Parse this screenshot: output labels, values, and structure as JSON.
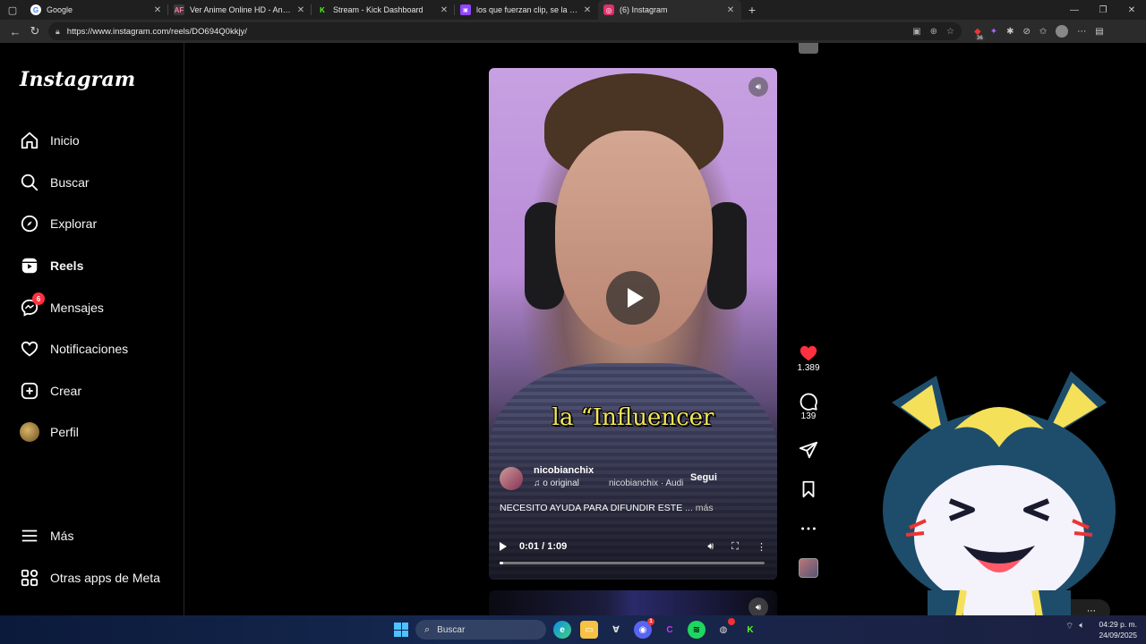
{
  "browser": {
    "tabs": [
      {
        "title": "Google",
        "favicon_color": "#ffffff",
        "favicon_glyph": "G"
      },
      {
        "title": "Ver Anime Online HD - AnimeFLV",
        "favicon_color": "#3a3a3a",
        "favicon_glyph": "AF"
      },
      {
        "title": "Stream - Kick Dashboard",
        "favicon_color": "#53fc18",
        "favicon_glyph": "K"
      },
      {
        "title": "los que fuerzan clip, se la comen",
        "favicon_color": "#9146ff",
        "favicon_glyph": "▣"
      },
      {
        "title": "(6) Instagram",
        "favicon_color": "#e1306c",
        "favicon_glyph": "◎"
      }
    ],
    "active_tab_index": 4,
    "url": "https://www.instagram.com/reels/DO694Q0kkjy/",
    "extension_badge": "36"
  },
  "instagram": {
    "logo": "Instagram",
    "nav": {
      "home": "Inicio",
      "search": "Buscar",
      "explore": "Explorar",
      "reels": "Reels",
      "messages": "Mensajes",
      "messages_badge": "6",
      "notifications": "Notificaciones",
      "create": "Crear",
      "profile": "Perfil",
      "more": "Más",
      "meta_apps": "Otras apps de Meta"
    },
    "reel": {
      "overlay_caption": "la “Influencer",
      "author": "nicobianchix",
      "audio_label": "♫ o original",
      "audio_label2": "nicobianchix · Audi",
      "follow": "Segui",
      "description": "NECESITO AYUDA PARA DIFUNDIR ESTE",
      "more": "... más",
      "time_current": "0:01",
      "time_sep": " / ",
      "time_total": "1:09",
      "progress_fraction": 0.015
    },
    "actions": {
      "likes": "1.389",
      "comments": "139"
    },
    "colors": {
      "like": "#ff3040",
      "caption": "#f3e55a"
    }
  },
  "taskbar": {
    "search_placeholder": "Buscar",
    "discord_badge": "1",
    "time": "04:29 p. m.",
    "date": "24/09/2025"
  }
}
